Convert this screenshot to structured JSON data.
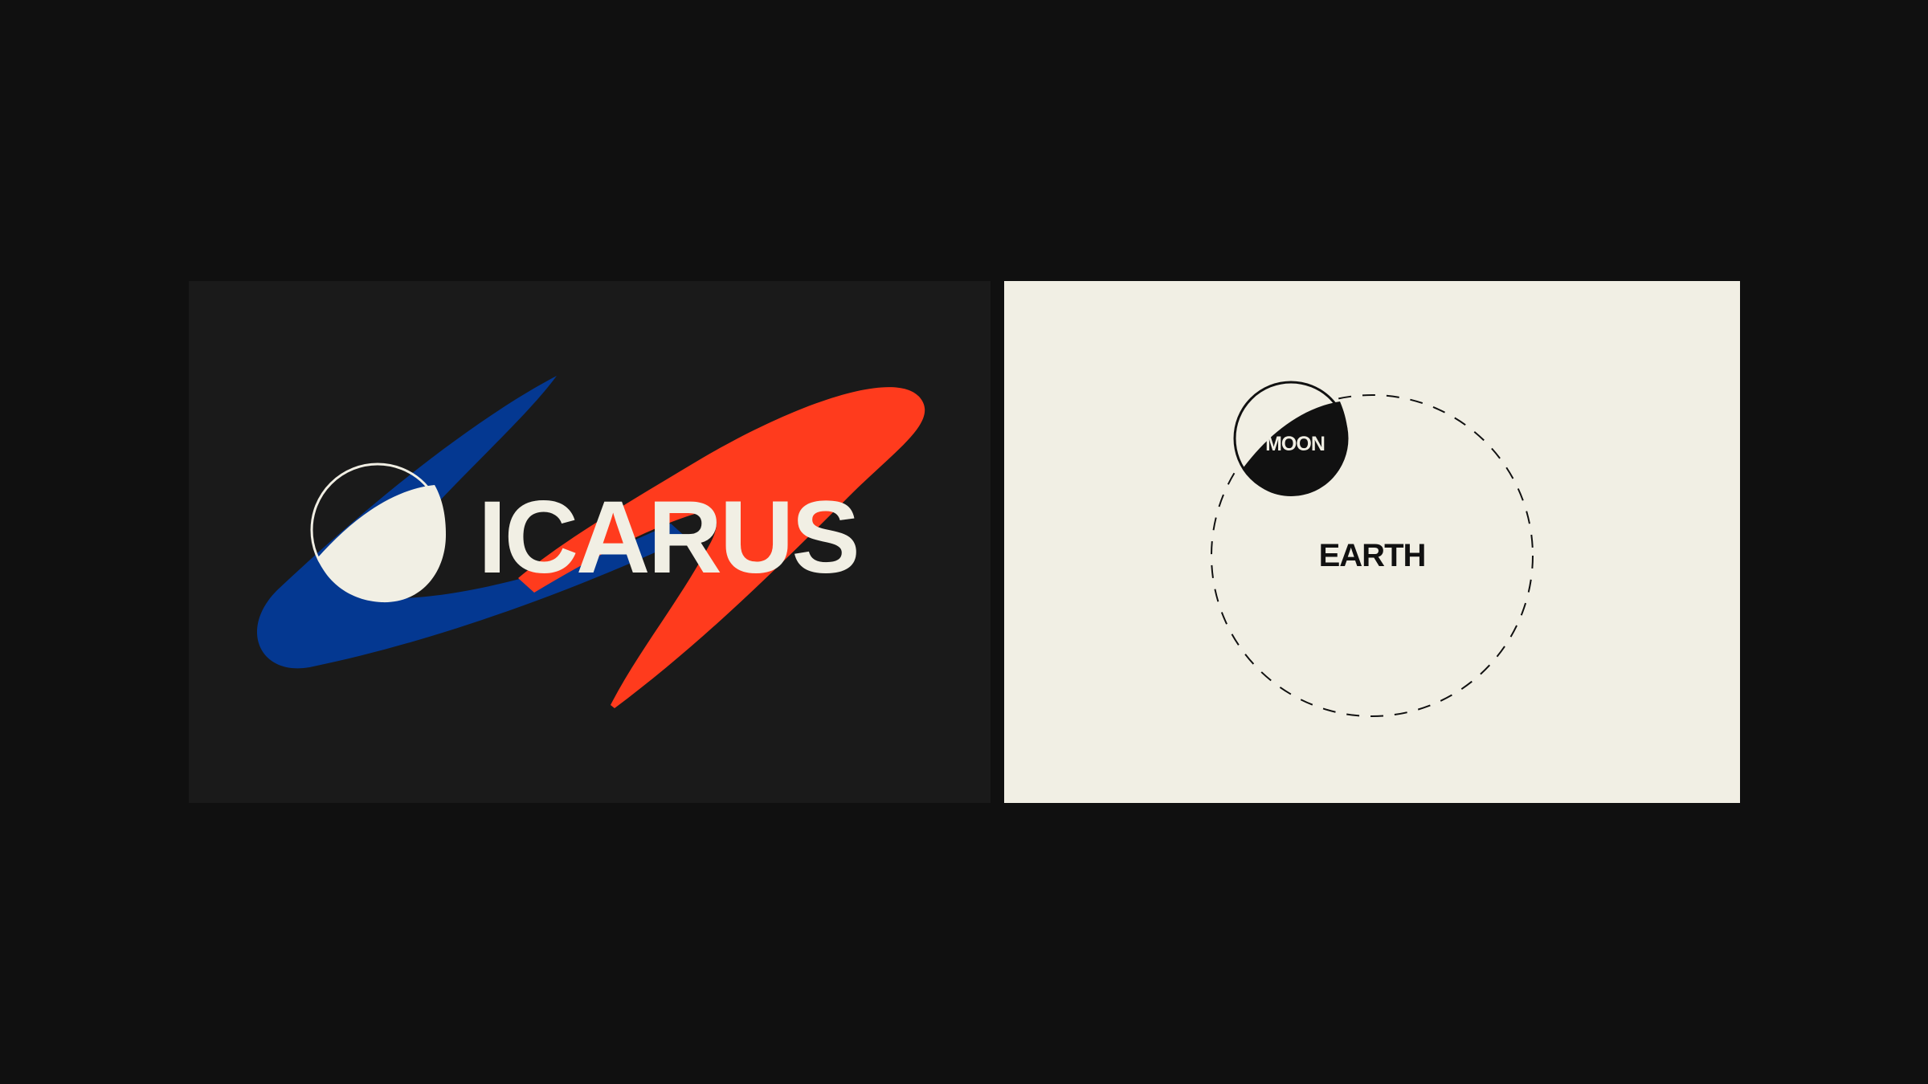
{
  "left_panel": {
    "wordmark": "ICARUS",
    "colors": {
      "background": "#1a1a1a",
      "blue_swoosh": "#043891",
      "red_swoosh": "#ff3b1d",
      "cream": "#f1efe4"
    }
  },
  "right_panel": {
    "moon_label": "MOON",
    "earth_label": "EARTH",
    "colors": {
      "background": "#f1efe4",
      "ink": "#111111"
    }
  },
  "page": {
    "background": "#101010"
  }
}
